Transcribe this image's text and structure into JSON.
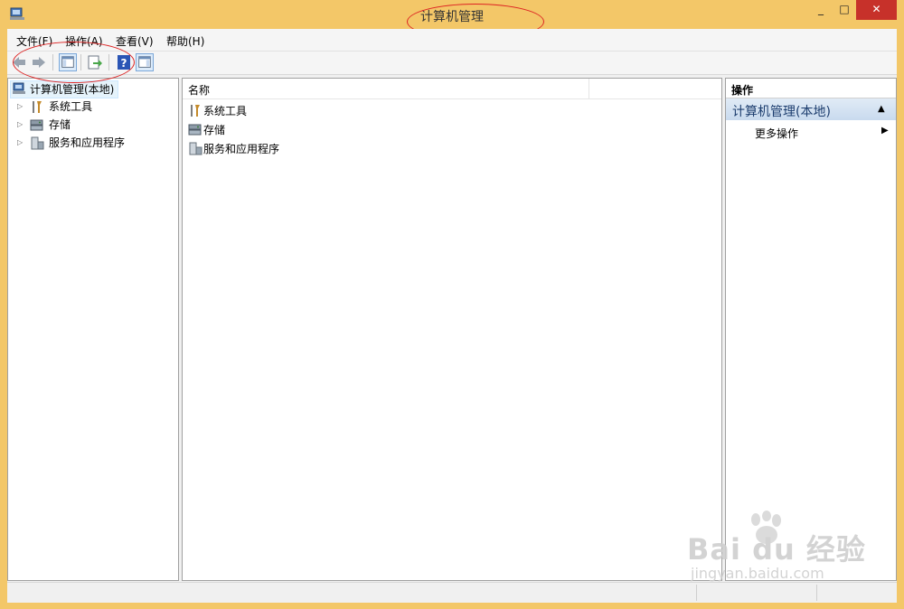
{
  "window": {
    "title": "计算机管理",
    "controls": {
      "minimize": "_",
      "maximize": "□",
      "close": "✕"
    },
    "frame_color": "#f3c768"
  },
  "menubar": {
    "items": [
      {
        "label": "文件(F)"
      },
      {
        "label": "操作(A)"
      },
      {
        "label": "查看(V)"
      },
      {
        "label": "帮助(H)"
      }
    ]
  },
  "toolbar": {
    "buttons": [
      "back-arrow-icon",
      "forward-arrow-icon",
      "show-hide-tree-icon",
      "export-list-icon",
      "help-icon",
      "show-hide-action-pane-icon"
    ]
  },
  "tree": {
    "root": {
      "label": "计算机管理(本地)",
      "icon": "computer-management-icon"
    },
    "children": [
      {
        "label": "系统工具",
        "icon": "tools-icon"
      },
      {
        "label": "存储",
        "icon": "storage-icon"
      },
      {
        "label": "服务和应用程序",
        "icon": "services-icon"
      }
    ]
  },
  "list": {
    "column_header": "名称",
    "rows": [
      {
        "label": "系统工具",
        "icon": "tools-icon"
      },
      {
        "label": "存储",
        "icon": "storage-icon"
      },
      {
        "label": "服务和应用程序",
        "icon": "services-icon"
      }
    ]
  },
  "actions": {
    "header": "操作",
    "section": "计算机管理(本地)",
    "items": [
      {
        "label": "更多操作"
      }
    ]
  },
  "watermark": {
    "logo": "Bai du 经验",
    "url": "jingyan.baidu.com"
  },
  "colors": {
    "selection": "#e5f3fb",
    "action_section": "#c9daee",
    "close_button": "#c7312a",
    "annotation": "#dd2222"
  }
}
